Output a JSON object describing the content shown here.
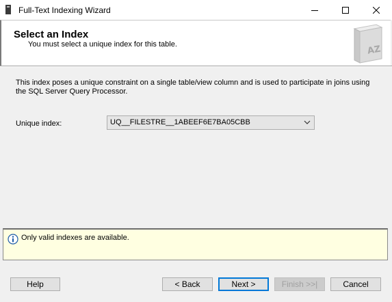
{
  "window": {
    "title": "Full-Text Indexing Wizard"
  },
  "header": {
    "title": "Select an Index",
    "subtitle": "You must select a unique index for this table."
  },
  "description": "This index poses a unique constraint on a single table/view column and is used to participate in joins using the SQL Server Query Processor.",
  "unique_index": {
    "label": "Unique index:",
    "value": "UQ__FILESTRE__1ABEEF6E7BA05CBB"
  },
  "info": {
    "text": "Only valid indexes are available."
  },
  "buttons": {
    "help": "Help",
    "back": "< Back",
    "next": "Next >",
    "finish": "Finish >>|",
    "cancel": "Cancel"
  },
  "icons": {
    "minimize": "minimize-icon",
    "maximize": "maximize-icon",
    "close": "close-icon",
    "dropdown": "chevron-down-icon",
    "info": "info-icon",
    "book": "az-book-icon"
  },
  "colors": {
    "info_background": "#ffffe1",
    "default_button_border": "#0078d7"
  }
}
